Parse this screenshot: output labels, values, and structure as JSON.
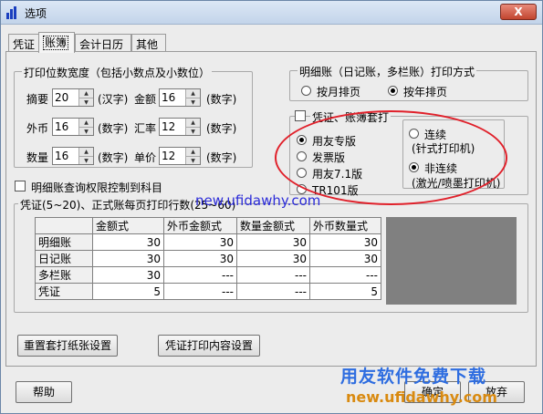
{
  "window": {
    "title": "选项",
    "close_label": "X"
  },
  "tabs": [
    {
      "label": "凭证"
    },
    {
      "label": "账簿"
    },
    {
      "label": "会计日历"
    },
    {
      "label": "其他"
    }
  ],
  "print_width": {
    "legend": "打印位数宽度（包括小数点及小数位）",
    "rows": [
      {
        "left_label": "摘要",
        "left_value": "20",
        "left_unit": "(汉字)",
        "right_label": "金额",
        "right_value": "16",
        "right_unit": "(数字)"
      },
      {
        "left_label": "外币",
        "left_value": "16",
        "left_unit": "(数字)",
        "right_label": "汇率",
        "right_value": "12",
        "right_unit": "(数字)"
      },
      {
        "left_label": "数量",
        "left_value": "16",
        "left_unit": "(数字)",
        "right_label": "单价",
        "right_value": "12",
        "right_unit": "(数字)"
      }
    ]
  },
  "detail_print_mode": {
    "legend": "明细账（日记账，多栏账）打印方式",
    "options": [
      {
        "label": "按月排页",
        "selected": false
      },
      {
        "label": "按年排页",
        "selected": true
      }
    ]
  },
  "preprinted": {
    "legend": "凭证、账簿套打",
    "checked": false,
    "types": [
      {
        "label": "用友专版",
        "selected": true
      },
      {
        "label": "发票版",
        "selected": false
      },
      {
        "label": "用友7.1版",
        "selected": false
      },
      {
        "label": "TR101版",
        "selected": false
      }
    ],
    "continuity": [
      {
        "label": "连续",
        "sub": "(针式打印机)",
        "selected": false
      },
      {
        "label": "非连续",
        "sub": "(激光/喷墨打印机)",
        "selected": true
      }
    ]
  },
  "control_to_subject": {
    "label": "明细账查询权限控制到科目",
    "checked": false
  },
  "rows_per_page": {
    "legend": "凭证(5~20)、正式账每页打印行数(25~60)",
    "columns": [
      "金额式",
      "外币金额式",
      "数量金额式",
      "外币数量式"
    ],
    "rows": [
      {
        "name": "明细账",
        "values": [
          "30",
          "30",
          "30",
          "30"
        ]
      },
      {
        "name": "日记账",
        "values": [
          "30",
          "30",
          "30",
          "30"
        ]
      },
      {
        "name": "多栏账",
        "values": [
          "30",
          "---",
          "---",
          "---"
        ]
      },
      {
        "name": "凭证",
        "values": [
          "5",
          "---",
          "---",
          "5"
        ]
      }
    ]
  },
  "buttons": {
    "reset_paper": "重置套打纸张设置",
    "voucher_print_content": "凭证打印内容设置",
    "help": "帮助",
    "ok": "确定",
    "cancel": "放弃"
  },
  "watermarks": {
    "url_mid": "new.ufidawhy.com",
    "slogan": "用友软件免费下载",
    "url_bottom": "new.ufidawhy.com"
  },
  "colors": {
    "accent_red": "#e0202a",
    "watermark_blue": "#2e6de0",
    "watermark_orange": "#d98a10"
  }
}
